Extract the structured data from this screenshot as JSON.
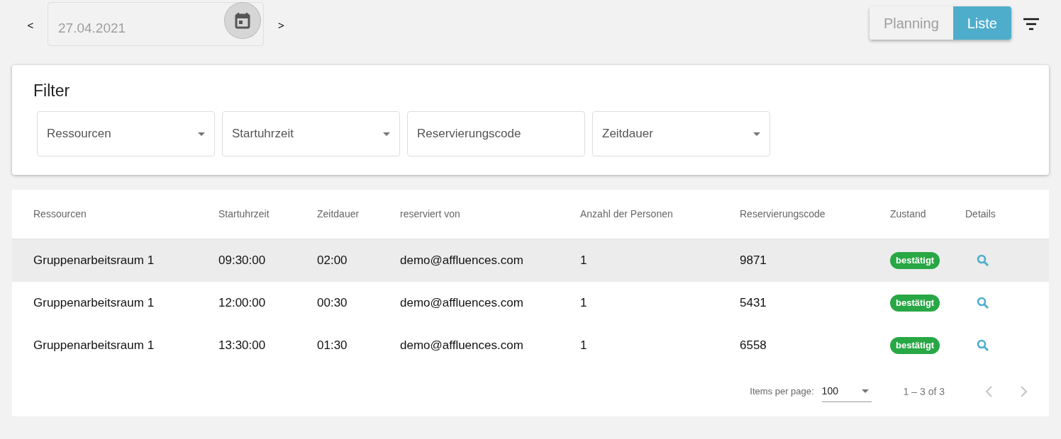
{
  "date_nav": {
    "prev": "<",
    "date": "27.04.2021",
    "next": ">"
  },
  "view_toggle": [
    {
      "label": "Planning",
      "selected": false
    },
    {
      "label": "Liste",
      "selected": true
    }
  ],
  "filter": {
    "title": "Filter",
    "fields": [
      {
        "kind": "select",
        "placeholder": "Ressourcen"
      },
      {
        "kind": "select",
        "placeholder": "Startuhrzeit"
      },
      {
        "kind": "text",
        "placeholder": "Reservierungscode"
      },
      {
        "kind": "select",
        "placeholder": "Zeitdauer"
      }
    ]
  },
  "table": {
    "columns": [
      "Ressourcen",
      "Startuhrzeit",
      "Zeitdauer",
      "reserviert von",
      "Anzahl der Personen",
      "Reservierungscode",
      "Zustand",
      "Details"
    ],
    "rows": [
      {
        "selected": true,
        "cells": [
          "Gruppenarbeitsraum 1",
          "09:30:00",
          "02:00",
          "demo@affluences.com",
          "1",
          "9871"
        ],
        "status": {
          "label": "bestätigt",
          "color": "#28a745"
        }
      },
      {
        "selected": false,
        "cells": [
          "Gruppenarbeitsraum 1",
          "12:00:00",
          "00:30",
          "demo@affluences.com",
          "1",
          "5431"
        ],
        "status": {
          "label": "bestätigt",
          "color": "#28a745"
        }
      },
      {
        "selected": false,
        "cells": [
          "Gruppenarbeitsraum 1",
          "13:30:00",
          "01:30",
          "demo@affluences.com",
          "1",
          "6558"
        ],
        "status": {
          "label": "bestätigt",
          "color": "#28a745"
        }
      }
    ]
  },
  "paginator": {
    "label": "Items per page:",
    "page_size": "100",
    "range": "1 – 3 of 3",
    "prev_disabled": true,
    "next_disabled": true
  }
}
